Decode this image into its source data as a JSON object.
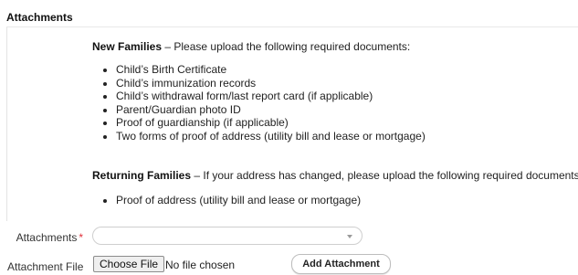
{
  "section_title": "Attachments",
  "new_families": {
    "heading": "New Families",
    "text": " – Please upload the following required documents:",
    "items": [
      "Child’s Birth Certificate",
      "Child’s immunization records",
      "Child’s withdrawal form/last report card (if applicable)",
      "Parent/Guardian photo ID",
      "Proof of guardianship (if applicable)",
      "Two forms of proof of address (utility bill and lease or mortgage)"
    ]
  },
  "returning_families": {
    "heading": "Returning Families",
    "text": " – If your address has changed, please upload the following required documents:",
    "items": [
      "Proof of address (utility bill and lease or mortgage)"
    ]
  },
  "attachments_field": {
    "label": "Attachments",
    "required_mark": "*",
    "value": ""
  },
  "attachment_file": {
    "label": "Attachment File",
    "choose_button": "Choose File",
    "status": "No file chosen",
    "add_button": "Add Attachment"
  },
  "colors": {
    "required": "#e0303a",
    "border": "#cfcfcf"
  }
}
